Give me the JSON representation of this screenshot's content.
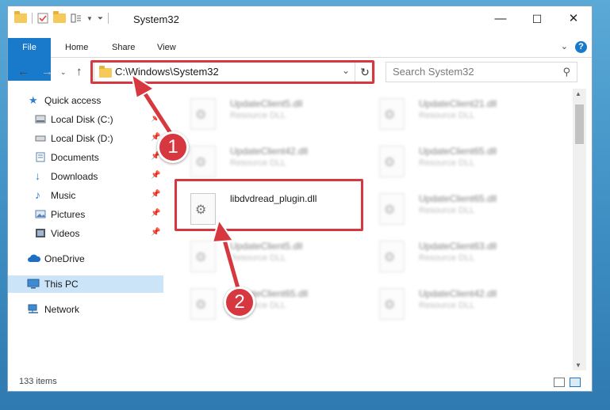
{
  "window": {
    "title": "System32",
    "controls": {
      "minimize": "—",
      "maximize": "☐",
      "close": "✕"
    }
  },
  "ribbon": {
    "tabs": [
      "File",
      "Home",
      "Share",
      "View"
    ],
    "help": "?"
  },
  "navigation": {
    "address": "C:\\Windows\\System32",
    "search_placeholder": "Search System32"
  },
  "nav_pane": {
    "items": [
      {
        "label": "Quick access",
        "icon": "star-icon"
      },
      {
        "label": "Local Disk (C:)",
        "icon": "drive-icon",
        "pinned": true
      },
      {
        "label": "Local Disk (D:)",
        "icon": "drive-icon",
        "pinned": true
      },
      {
        "label": "Documents",
        "icon": "documents-icon",
        "pinned": true
      },
      {
        "label": "Downloads",
        "icon": "downloads-icon",
        "pinned": true
      },
      {
        "label": "Music",
        "icon": "music-icon",
        "pinned": true
      },
      {
        "label": "Pictures",
        "icon": "pictures-icon",
        "pinned": true
      },
      {
        "label": "Videos",
        "icon": "videos-icon",
        "pinned": true
      },
      {
        "label": "OneDrive",
        "icon": "cloud-icon"
      },
      {
        "label": "This PC",
        "icon": "pc-icon",
        "selected": true
      },
      {
        "label": "Network",
        "icon": "network-icon"
      }
    ]
  },
  "files": {
    "left": [
      {
        "name": "UpdateClient5.dll",
        "desc": "Resource DLL"
      },
      {
        "name": "UpdateClient42.dll",
        "desc": "Resource DLL"
      },
      {
        "name": "libdvdread_plugin.dll",
        "desc": ""
      },
      {
        "name": "UpdateClient5.dll",
        "desc": "Resource DLL"
      },
      {
        "name": "UpdateClient65.dll",
        "desc": "Resource DLL"
      }
    ],
    "right": [
      {
        "name": "UpdateClient21.dll",
        "desc": "Resource DLL"
      },
      {
        "name": "UpdateClient65.dll",
        "desc": "Resource DLL"
      },
      {
        "name": "UpdateClient65.dll",
        "desc": "Resource DLL"
      },
      {
        "name": "UpdateClient63.dll",
        "desc": "Resource DLL"
      },
      {
        "name": "UpdateClient42.dll",
        "desc": "Resource DLL"
      }
    ]
  },
  "status": {
    "count": "133 items"
  },
  "callouts": [
    "1",
    "2"
  ],
  "colors": {
    "accent": "#1979ca",
    "highlight": "#d7373f",
    "selected": "#cce4f7"
  }
}
